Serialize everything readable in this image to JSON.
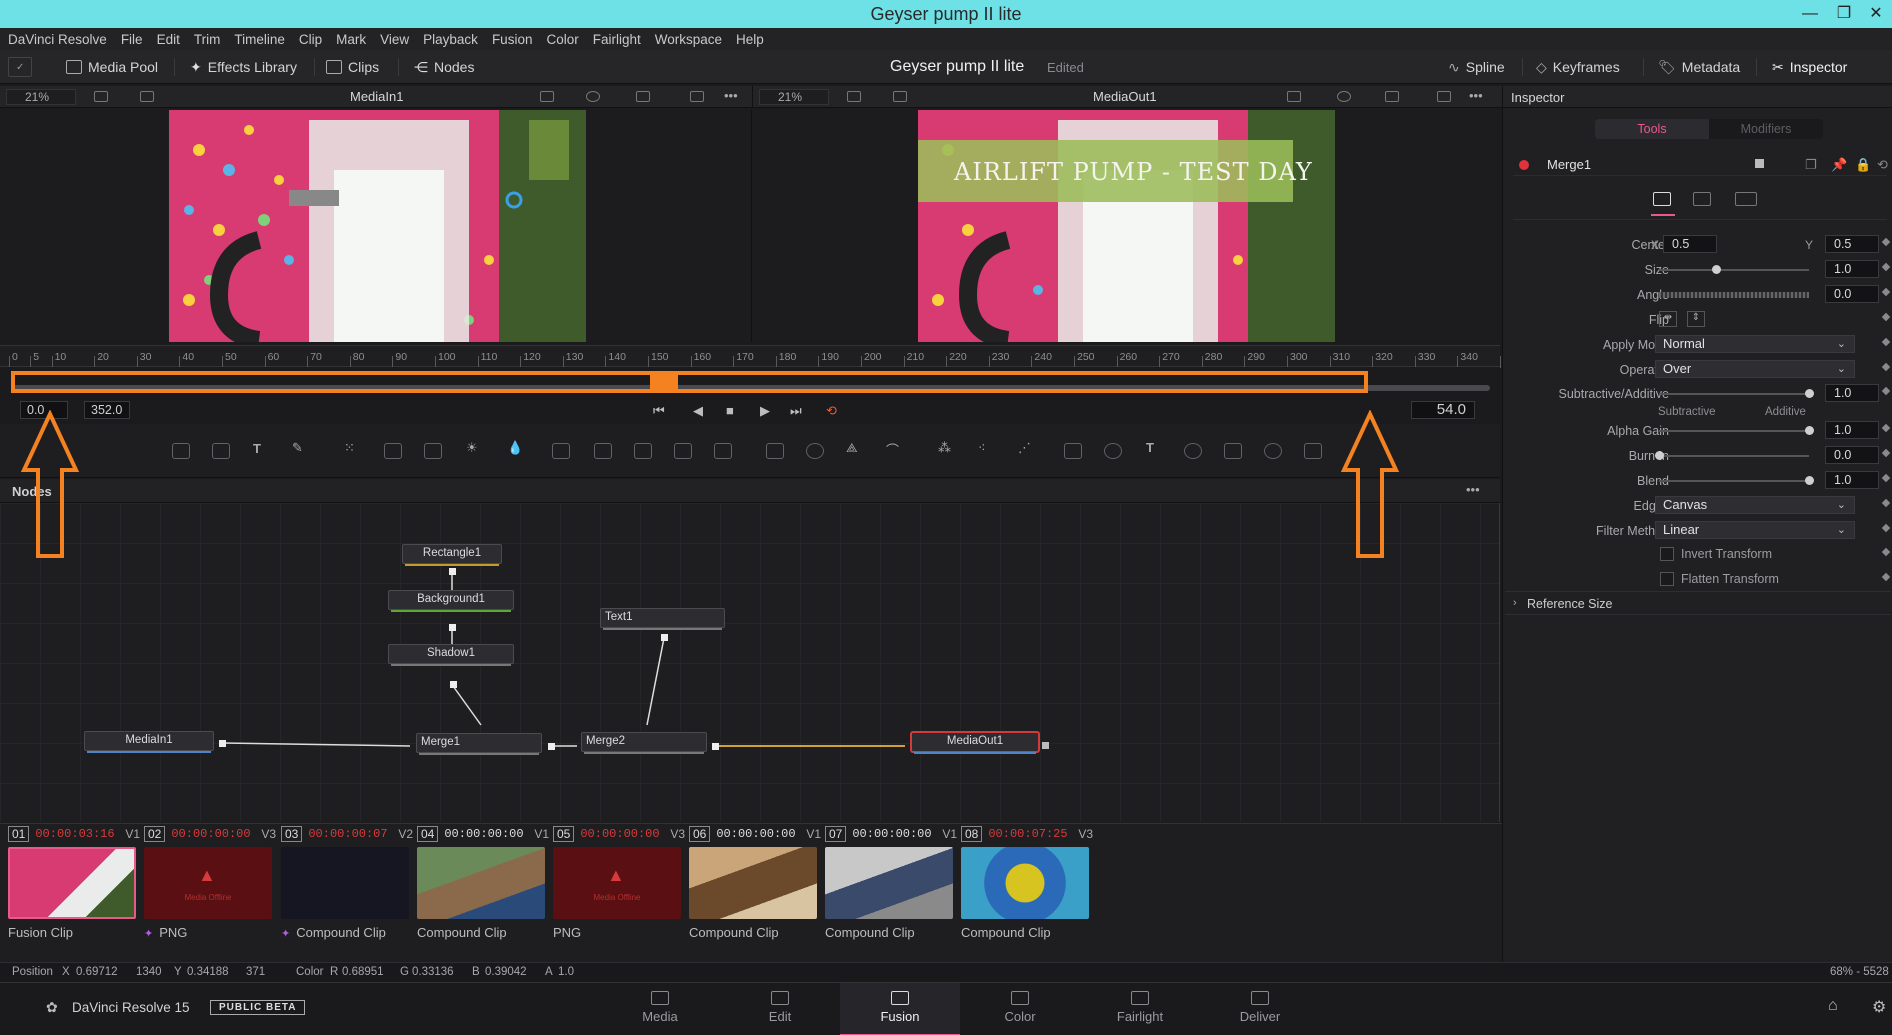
{
  "window": {
    "title": "Geyser pump II lite",
    "min_glyph": "—",
    "max_glyph": "❐",
    "close_glyph": "✕"
  },
  "menu": [
    "DaVinci Resolve",
    "File",
    "Edit",
    "Trim",
    "Timeline",
    "Clip",
    "Mark",
    "View",
    "Playback",
    "Fusion",
    "Color",
    "Fairlight",
    "Workspace",
    "Help"
  ],
  "toolbar": {
    "media_pool": "Media Pool",
    "effects_library": "Effects Library",
    "clips": "Clips",
    "nodes": "Nodes",
    "project_title": "Geyser pump II lite",
    "project_status": "Edited",
    "spline": "Spline",
    "keyframes": "Keyframes",
    "metadata": "Metadata",
    "inspector": "Inspector"
  },
  "viewer_left": {
    "zoom": "21%",
    "title": "MediaIn1"
  },
  "viewer_right": {
    "zoom": "21%",
    "title": "MediaOut1",
    "overlay_text": "AIRLIFT PUMP - TEST DAY"
  },
  "ruler_ticks": [
    "0",
    "5",
    "10",
    "20",
    "30",
    "40",
    "50",
    "60",
    "70",
    "80",
    "90",
    "100",
    "110",
    "120",
    "130",
    "140",
    "150",
    "160",
    "170",
    "180",
    "190",
    "200",
    "210",
    "220",
    "230",
    "240",
    "250",
    "260",
    "270",
    "280",
    "290",
    "300",
    "310",
    "320",
    "330",
    "340",
    "35"
  ],
  "transport": {
    "start": "0.0",
    "end": "352.0",
    "current": "54.0",
    "buttons": [
      "⏮",
      "◀",
      "■",
      "▶",
      "⏭",
      "⟲"
    ]
  },
  "nodes_panel": {
    "title": "Nodes",
    "more": "•••"
  },
  "nodes": {
    "rectangle1": "Rectangle1",
    "background1": "Background1",
    "shadow1": "Shadow1",
    "text1": "Text1",
    "mediain1": "MediaIn1",
    "merge1": "Merge1",
    "merge2": "Merge2",
    "mediaout1": "MediaOut1"
  },
  "clips": [
    {
      "num": "01",
      "tc": "00:00:03:16",
      "track": "V1",
      "label": "Fusion Clip",
      "tc_color": "#d63b3b"
    },
    {
      "num": "02",
      "tc": "00:00:00:00",
      "track": "V3",
      "label": "PNG",
      "tc_color": "#d63b3b",
      "offline": "Media Offline"
    },
    {
      "num": "03",
      "tc": "00:00:00:07",
      "track": "V2",
      "label": "Compound Clip",
      "tc_color": "#d63b3b"
    },
    {
      "num": "04",
      "tc": "00:00:00:00",
      "track": "V1",
      "label": "Compound Clip",
      "tc_color": "#dddddd"
    },
    {
      "num": "05",
      "tc": "00:00:00:00",
      "track": "V3",
      "label": "PNG",
      "tc_color": "#d63b3b",
      "offline": "Media Offline"
    },
    {
      "num": "06",
      "tc": "00:00:00:00",
      "track": "V1",
      "label": "Compound Clip",
      "tc_color": "#dddddd"
    },
    {
      "num": "07",
      "tc": "00:00:00:00",
      "track": "V1",
      "label": "Compound Clip",
      "tc_color": "#dddddd"
    },
    {
      "num": "08",
      "tc": "00:00:07:25",
      "track": "V3",
      "label": "Compound Clip",
      "tc_color": "#d63b3b"
    }
  ],
  "status": {
    "position_label": "Position",
    "x_label": "X",
    "x": "0.69712",
    "px": "1340",
    "y_label": "Y",
    "y": "0.34188",
    "py": "371",
    "color_label": "Color",
    "r_label": "R",
    "r": "0.68951",
    "g_label": "G",
    "g": "0.33136",
    "b_label": "B",
    "b": "0.39042",
    "a_label": "A",
    "a": "1.0",
    "right": "68% - 5528"
  },
  "pages": {
    "app": "DaVinci Resolve 15",
    "beta": "PUBLIC BETA",
    "items": [
      "Media",
      "Edit",
      "Fusion",
      "Color",
      "Fairlight",
      "Deliver"
    ],
    "active": "Fusion"
  },
  "inspector": {
    "title": "Inspector",
    "tab_tools": "Tools",
    "tab_modifiers": "Modifiers",
    "node_name": "Merge1",
    "center_label": "Center",
    "center_x_label": "X",
    "center_x": "0.5",
    "center_y_label": "Y",
    "center_y": "0.5",
    "size_label": "Size",
    "size": "1.0",
    "angle_label": "Angle",
    "angle": "0.0",
    "flip_label": "Flip",
    "apply_mode_label": "Apply Mode",
    "apply_mode": "Normal",
    "operator_label": "Operator",
    "operator": "Over",
    "subadd_label": "Subtractive/Additive",
    "subadd": "1.0",
    "sub_caption": "Subtractive",
    "add_caption": "Additive",
    "alpha_gain_label": "Alpha Gain",
    "alpha_gain": "1.0",
    "burn_in_label": "Burn In",
    "burn_in": "0.0",
    "blend_label": "Blend",
    "blend": "1.0",
    "edges_label": "Edges",
    "edges": "Canvas",
    "filter_label": "Filter Method",
    "filter": "Linear",
    "invert_transform": "Invert Transform",
    "flatten_transform": "Flatten Transform",
    "reference_size": "Reference Size",
    "slider_levels": {
      "size": 0.38,
      "angle": 0.0,
      "subadd": 1.0,
      "alpha_gain": 1.0,
      "burn_in": 0.0,
      "blend": 1.0
    }
  },
  "colors": {
    "accent": "#f58220",
    "title_bar": "#6ee1e7",
    "selected_red": "#d23b3b"
  }
}
